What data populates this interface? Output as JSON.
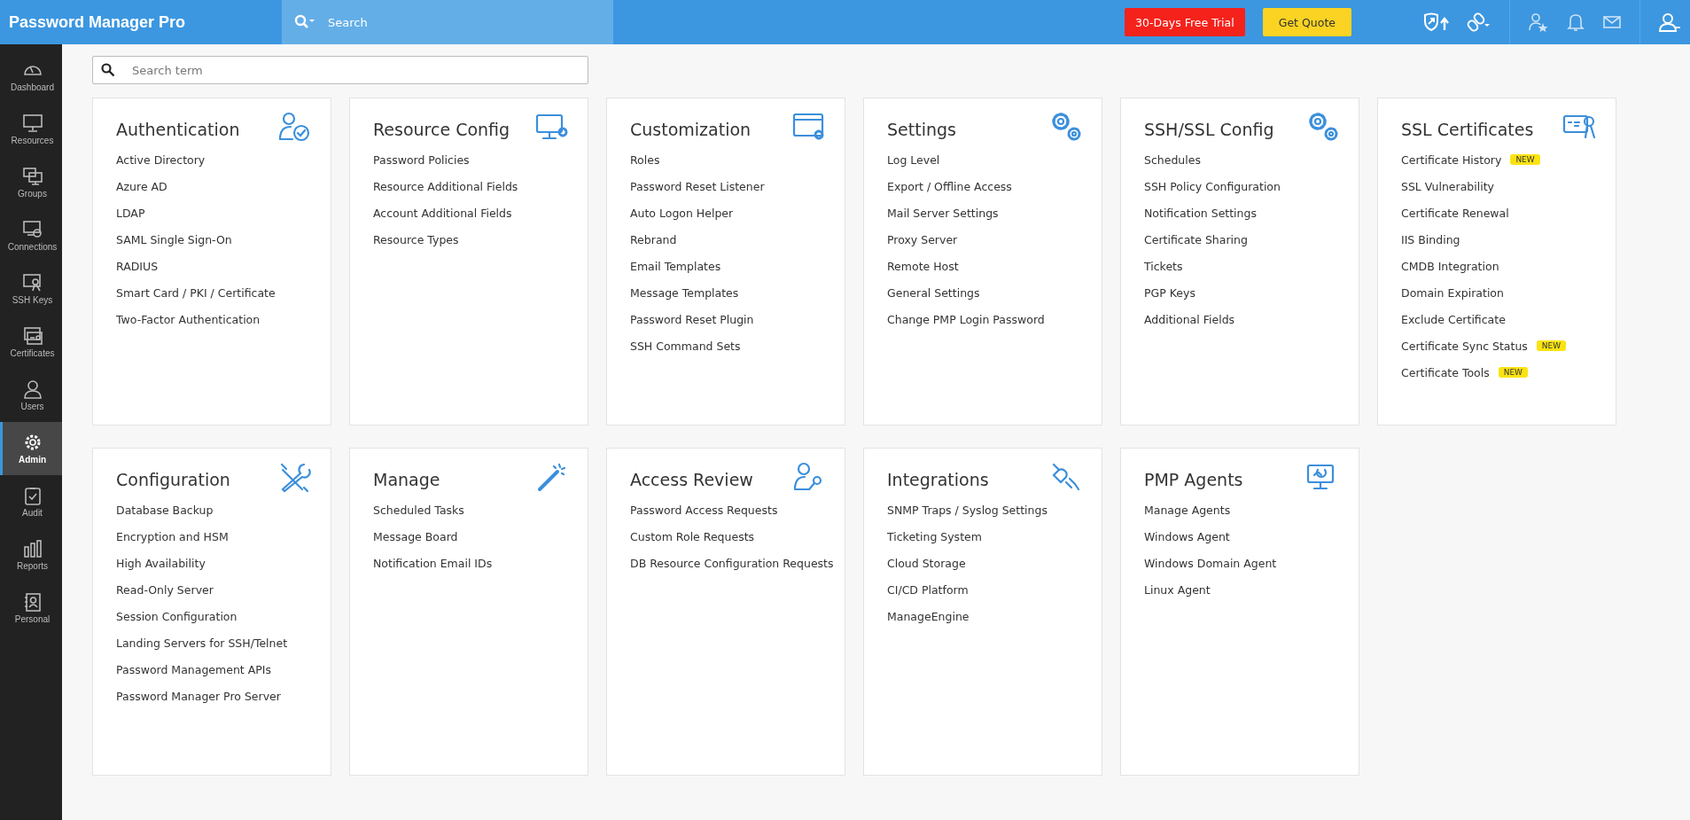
{
  "header": {
    "logo": "Password Manager Pro",
    "search": {
      "placeholder": "Search"
    },
    "trial_button": "30-Days Free Trial",
    "quote_button": "Get Quote"
  },
  "sidebar": {
    "items": [
      {
        "label": "Dashboard",
        "selected": false
      },
      {
        "label": "Resources",
        "selected": false
      },
      {
        "label": "Groups",
        "selected": false
      },
      {
        "label": "Connections",
        "selected": false
      },
      {
        "label": "SSH Keys",
        "selected": false
      },
      {
        "label": "Certificates",
        "selected": false
      },
      {
        "label": "Users",
        "selected": false
      },
      {
        "label": "Admin",
        "selected": true
      },
      {
        "label": "Audit",
        "selected": false
      },
      {
        "label": "Reports",
        "selected": false
      },
      {
        "label": "Personal",
        "selected": false
      }
    ]
  },
  "search": {
    "placeholder": "Search term"
  },
  "cards": [
    {
      "title": "Authentication",
      "items": [
        {
          "label": "Active Directory"
        },
        {
          "label": "Azure AD"
        },
        {
          "label": "LDAP"
        },
        {
          "label": "SAML Single Sign-On"
        },
        {
          "label": "RADIUS"
        },
        {
          "label": "Smart Card / PKI / Certificate"
        },
        {
          "label": "Two-Factor Authentication"
        }
      ]
    },
    {
      "title": "Resource Config",
      "items": [
        {
          "label": "Password Policies"
        },
        {
          "label": "Resource Additional Fields"
        },
        {
          "label": "Account Additional Fields"
        },
        {
          "label": "Resource Types"
        }
      ]
    },
    {
      "title": "Customization",
      "items": [
        {
          "label": "Roles"
        },
        {
          "label": "Password Reset Listener"
        },
        {
          "label": "Auto Logon Helper"
        },
        {
          "label": "Rebrand"
        },
        {
          "label": "Email Templates"
        },
        {
          "label": "Message Templates"
        },
        {
          "label": "Password Reset Plugin"
        },
        {
          "label": "SSH Command Sets"
        }
      ]
    },
    {
      "title": "Settings",
      "items": [
        {
          "label": "Log Level"
        },
        {
          "label": "Export / Offline Access"
        },
        {
          "label": "Mail Server Settings"
        },
        {
          "label": "Proxy Server"
        },
        {
          "label": "Remote Host"
        },
        {
          "label": "General Settings"
        },
        {
          "label": "Change PMP Login Password"
        }
      ]
    },
    {
      "title": "SSH/SSL Config",
      "items": [
        {
          "label": "Schedules"
        },
        {
          "label": "SSH Policy Configuration"
        },
        {
          "label": "Notification Settings"
        },
        {
          "label": "Certificate Sharing"
        },
        {
          "label": "Tickets"
        },
        {
          "label": "PGP Keys"
        },
        {
          "label": "Additional Fields"
        }
      ]
    },
    {
      "title": "SSL Certificates",
      "items": [
        {
          "label": "Certificate History",
          "badge": "NEW"
        },
        {
          "label": "SSL Vulnerability"
        },
        {
          "label": "Certificate Renewal"
        },
        {
          "label": "IIS Binding"
        },
        {
          "label": "CMDB Integration"
        },
        {
          "label": "Domain Expiration"
        },
        {
          "label": "Exclude Certificate"
        },
        {
          "label": "Certificate Sync Status",
          "badge": "NEW"
        },
        {
          "label": "Certificate Tools",
          "badge": "NEW"
        }
      ]
    },
    {
      "title": "Configuration",
      "items": [
        {
          "label": "Database Backup"
        },
        {
          "label": "Encryption and HSM"
        },
        {
          "label": "High Availability"
        },
        {
          "label": "Read-Only Server"
        },
        {
          "label": "Session Configuration"
        },
        {
          "label": "Landing Servers for SSH/Telnet"
        },
        {
          "label": "Password Management APIs"
        },
        {
          "label": "Password Manager Pro Server"
        }
      ]
    },
    {
      "title": "Manage",
      "items": [
        {
          "label": "Scheduled Tasks"
        },
        {
          "label": "Message Board"
        },
        {
          "label": "Notification Email IDs"
        }
      ]
    },
    {
      "title": "Access Review",
      "items": [
        {
          "label": "Password Access Requests"
        },
        {
          "label": "Custom Role Requests"
        },
        {
          "label": "DB Resource Configuration Requests"
        }
      ]
    },
    {
      "title": "Integrations",
      "items": [
        {
          "label": "SNMP Traps / Syslog Settings"
        },
        {
          "label": "Ticketing System"
        },
        {
          "label": "Cloud Storage"
        },
        {
          "label": "CI/CD Platform"
        },
        {
          "label": "ManageEngine"
        }
      ]
    },
    {
      "title": "PMP Agents",
      "items": [
        {
          "label": "Manage Agents"
        },
        {
          "label": "Windows Agent"
        },
        {
          "label": "Windows Domain Agent"
        },
        {
          "label": "Linux Agent"
        }
      ]
    }
  ]
}
